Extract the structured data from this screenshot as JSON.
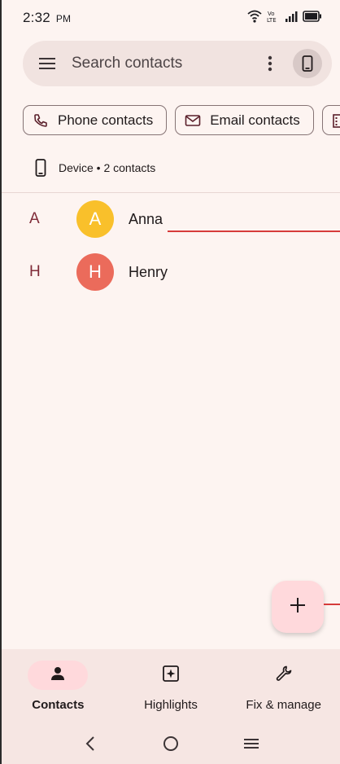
{
  "status_bar": {
    "time": "2:32",
    "ampm": "PM",
    "icons": [
      "wifi-icon",
      "volte-icon",
      "signal-icon",
      "battery-icon"
    ]
  },
  "search": {
    "placeholder": "Search contacts",
    "icons": [
      "menu-icon",
      "more-vert-icon",
      "device-avatar-icon"
    ]
  },
  "chips": [
    {
      "label": "Phone contacts",
      "icon": "phone-icon"
    },
    {
      "label": "Email contacts",
      "icon": "mail-icon"
    }
  ],
  "device_header": {
    "label": "Device • 2 contacts",
    "icon": "phone-device-icon"
  },
  "contacts": [
    {
      "section": "A",
      "initial": "A",
      "name": "Anna",
      "color": "#f9c02b"
    },
    {
      "section": "H",
      "initial": "H",
      "name": "Henry",
      "color": "#eb6b5b"
    }
  ],
  "fab": {
    "icon": "plus-icon"
  },
  "bottom_nav": {
    "items": [
      {
        "label": "Contacts",
        "icon": "person-icon",
        "active": true
      },
      {
        "label": "Highlights",
        "icon": "highlights-icon",
        "active": false
      },
      {
        "label": "Fix & manage",
        "icon": "wrench-icon",
        "active": false
      }
    ]
  },
  "system_nav": [
    "back-icon",
    "home-icon",
    "recents-icon"
  ],
  "colors": {
    "background": "#fdf4f1",
    "accent": "#ffd9dc",
    "section_letter": "#7f2b38",
    "annotation_line": "#d63b3b"
  }
}
